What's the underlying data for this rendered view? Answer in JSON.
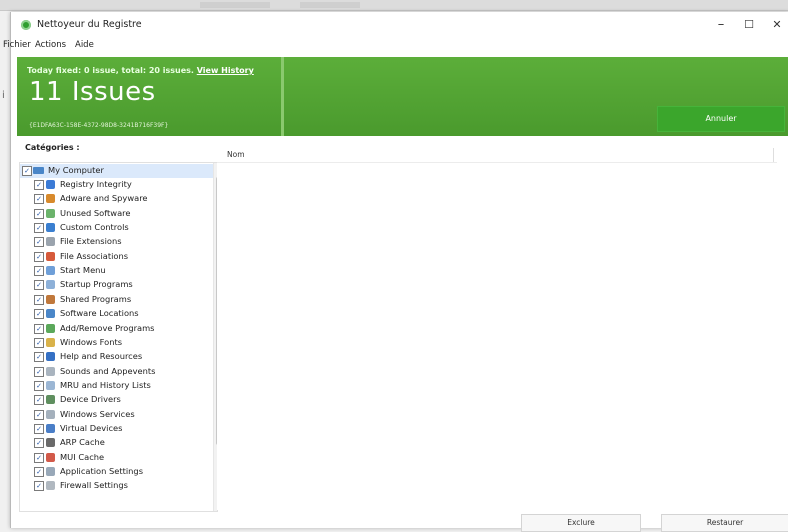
{
  "window": {
    "title": "Nettoyeur du Registre",
    "minimize": "–",
    "maximize": "☐",
    "close": "✕"
  },
  "menu": [
    "Fichier",
    "Actions",
    "Aide"
  ],
  "banner": {
    "summary": "Today fixed: 0 issue, total: 20 issues.",
    "link": "View History",
    "count_label": "11 Issues",
    "guid": "{E1DFA63C-158E-4372-98D8-3241B716F39F}",
    "cancel_button": "Annuler"
  },
  "categories": {
    "header": "Catégories :",
    "root": "My Computer",
    "items": [
      {
        "label": "Registry Integrity",
        "icon": "registry-icon",
        "color": "#3b7bd6"
      },
      {
        "label": "Adware and Spyware",
        "icon": "spyware-icon",
        "color": "#d88a2c"
      },
      {
        "label": "Unused Software",
        "icon": "software-icon",
        "color": "#6bb36b"
      },
      {
        "label": "Custom Controls",
        "icon": "controls-icon",
        "color": "#3a7fd0"
      },
      {
        "label": "File Extensions",
        "icon": "file-extension-icon",
        "color": "#9aa3ad"
      },
      {
        "label": "File Associations",
        "icon": "file-association-icon",
        "color": "#d65a3b"
      },
      {
        "label": "Start Menu",
        "icon": "start-menu-icon",
        "color": "#6f9fd8"
      },
      {
        "label": "Startup Programs",
        "icon": "startup-icon",
        "color": "#8db0d8"
      },
      {
        "label": "Shared Programs",
        "icon": "shared-programs-icon",
        "color": "#c0783b"
      },
      {
        "label": "Software Locations",
        "icon": "software-location-icon",
        "color": "#4a86c8"
      },
      {
        "label": "Add/Remove Programs",
        "icon": "add-remove-icon",
        "color": "#5ba85b"
      },
      {
        "label": "Windows Fonts",
        "icon": "fonts-icon",
        "color": "#d9b24a"
      },
      {
        "label": "Help and Resources",
        "icon": "help-icon",
        "color": "#3570c4"
      },
      {
        "label": "Sounds and Appevents",
        "icon": "sound-icon",
        "color": "#a9b4bf"
      },
      {
        "label": "MRU and History Lists",
        "icon": "history-icon",
        "color": "#9bb6d4"
      },
      {
        "label": "Device Drivers",
        "icon": "driver-icon",
        "color": "#5f8f5f"
      },
      {
        "label": "Windows Services",
        "icon": "services-icon",
        "color": "#a4b0bc"
      },
      {
        "label": "Virtual Devices",
        "icon": "virtual-device-icon",
        "color": "#4a7ec7"
      },
      {
        "label": "ARP Cache",
        "icon": "arp-icon",
        "color": "#6a6a6a"
      },
      {
        "label": "MUI Cache",
        "icon": "mui-icon",
        "color": "#d25a4a"
      },
      {
        "label": "Application Settings",
        "icon": "app-settings-icon",
        "color": "#98a8b8"
      },
      {
        "label": "Firewall Settings",
        "icon": "firewall-icon",
        "color": "#b0b8c0"
      }
    ]
  },
  "list": {
    "column": "Nom"
  },
  "buttons": {
    "exclude": "Exclure",
    "restore": "Restaurer"
  }
}
